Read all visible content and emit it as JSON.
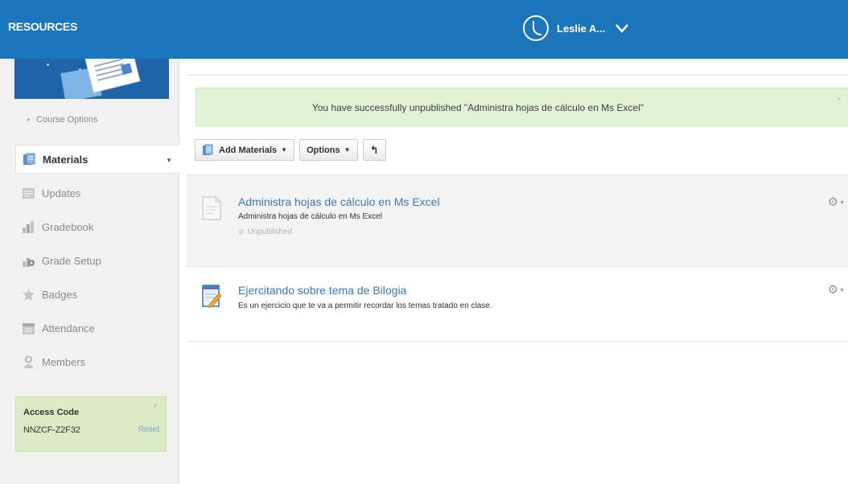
{
  "header": {
    "brand": "RESOURCES",
    "user_name": "Leslie A..."
  },
  "sidebar": {
    "course_options": "Course Options",
    "nav": [
      {
        "label": "Materials",
        "icon": "materials-icon",
        "active": true
      },
      {
        "label": "Updates",
        "icon": "updates-icon"
      },
      {
        "label": "Gradebook",
        "icon": "gradebook-icon"
      },
      {
        "label": "Grade Setup",
        "icon": "grade-setup-icon"
      },
      {
        "label": "Badges",
        "icon": "badge-icon"
      },
      {
        "label": "Attendance",
        "icon": "attendance-icon"
      },
      {
        "label": "Members",
        "icon": "members-icon"
      }
    ],
    "access_code": {
      "label": "Access Code",
      "code": "NNZCF-Z2F32",
      "reset": "Reset",
      "close": "×"
    }
  },
  "main": {
    "flash": {
      "message": "You have successfully unpublished \"Administra hojas de cálculo en Ms Excel\"",
      "close": "×"
    },
    "toolbar": {
      "add_materials": "Add Materials",
      "options": "Options",
      "undo": "↰"
    },
    "materials": [
      {
        "title": "Administra hojas de cálculo en Ms Excel",
        "description": "Administra hojas de cálculo en Ms Excel",
        "status": "Unpublished"
      },
      {
        "title": "Ejercitando sobre tema de Bilogia",
        "description": "Es un ejercicio que te va a permitir recordar los temas tratado en clase."
      }
    ]
  },
  "colors": {
    "header_blue": "#1b75bb",
    "link_blue": "#3f77b2",
    "success_green": "#e1f3d5",
    "access_green": "#d9ecc6"
  }
}
